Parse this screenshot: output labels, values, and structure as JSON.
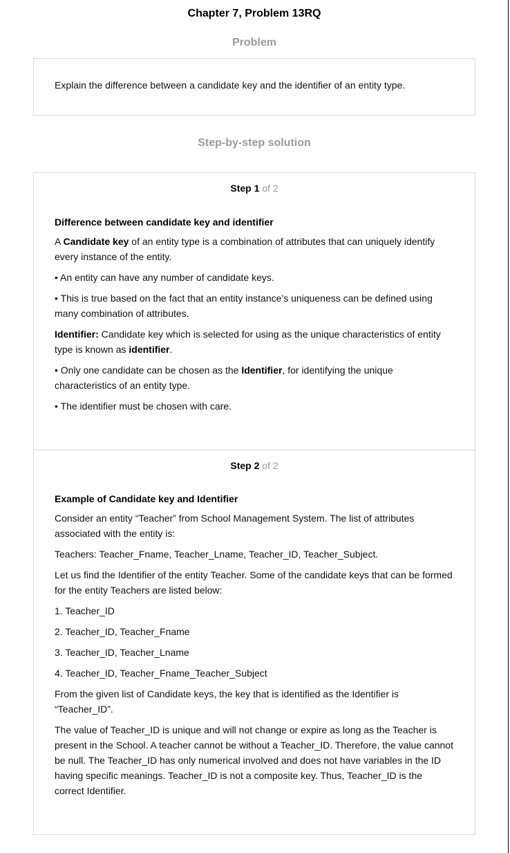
{
  "header": {
    "title": "Chapter 7, Problem 13RQ",
    "problem_label": "Problem",
    "solution_label": "Step-by-step solution"
  },
  "problem": {
    "text": "Explain the difference between a candidate key and the identifier of an entity type."
  },
  "steps": [
    {
      "label": "Step 1",
      "of": "of 2",
      "heading": "Difference between candidate key and identifier",
      "paragraphs": [
        {
          "pre": "A ",
          "bold": "Candidate key",
          "post": " of an entity type is a combination of attributes that can uniquely identify every instance of the entity."
        },
        {
          "text": "• An entity can have any number of candidate keys."
        },
        {
          "text": "• This is true based on the fact that an entity instance’s uniqueness can be defined using many combination of attributes."
        },
        {
          "bold": "Identifier:",
          "mid": " Candidate key which is selected for using as the unique characteristics of entity type is known as ",
          "bold2": "identifier",
          "post": "."
        },
        {
          "pre": "• Only one candidate can be chosen as the ",
          "bold": "Identifier",
          "post": ", for identifying the unique characteristics of an entity type."
        },
        {
          "text": "• The identifier must be chosen with care."
        }
      ]
    },
    {
      "label": "Step 2",
      "of": "of 2",
      "heading": "Example of Candidate key and Identifier",
      "paragraphs": [
        {
          "text": "Consider an entity “Teacher” from School Management System. The list of attributes associated with the entity is:"
        },
        {
          "text": "Teachers: Teacher_Fname, Teacher_Lname, Teacher_ID, Teacher_Subject."
        },
        {
          "text": "Let us find the Identifier of the entity Teacher. Some of the candidate keys that can be formed for the entity Teachers are listed below:"
        },
        {
          "text": "1. Teacher_ID"
        },
        {
          "text": "2. Teacher_ID, Teacher_Fname"
        },
        {
          "text": "3. Teacher_ID, Teacher_Lname"
        },
        {
          "text": "4. Teacher_ID, Teacher_Fname_Teacher_Subject"
        },
        {
          "text": "From the given list of Candidate keys, the key that is identified as the Identifier is “Teacher_ID”."
        },
        {
          "text": "The value of Teacher_ID is unique and will not change or expire as long as the Teacher is present in the School. A teacher cannot be without a Teacher_ID. Therefore, the value cannot be null. The Teacher_ID has only numerical involved and does not have variables in the ID having specific meanings. Teacher_ID is not a composite key. Thus, Teacher_ID is the correct Identifier."
        }
      ]
    }
  ]
}
